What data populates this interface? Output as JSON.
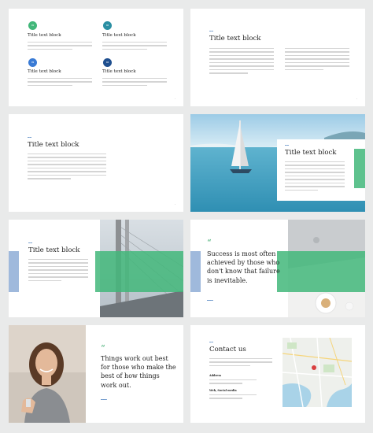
{
  "colors": {
    "green": "#42b77a",
    "teal": "#2b8fa3",
    "blue": "#3a7bd5",
    "navy": "#1f4f8f",
    "light_blue_bar": "#9fb9dc"
  },
  "slide1": {
    "items": [
      {
        "num": "01",
        "title": "Title text block"
      },
      {
        "num": "02",
        "title": "Title text block"
      },
      {
        "num": "03",
        "title": "Title text block"
      },
      {
        "num": "04",
        "title": "Title text block"
      }
    ]
  },
  "slide2": {
    "title": "Title text block"
  },
  "slide3": {
    "title": "Title text block"
  },
  "slide4": {
    "title": "Title text block"
  },
  "slide5": {
    "title": "Title text block"
  },
  "slide6": {
    "quote_mark": "“",
    "quote": "Success is most often achieved by those who don't know that failure is inevitable."
  },
  "slide7": {
    "quote_mark": "“",
    "quote": "Things work out best for those who make the best of how things work out."
  },
  "slide8": {
    "title": "Contact us",
    "address_label": "Address",
    "social_label": "Web, Social media"
  }
}
